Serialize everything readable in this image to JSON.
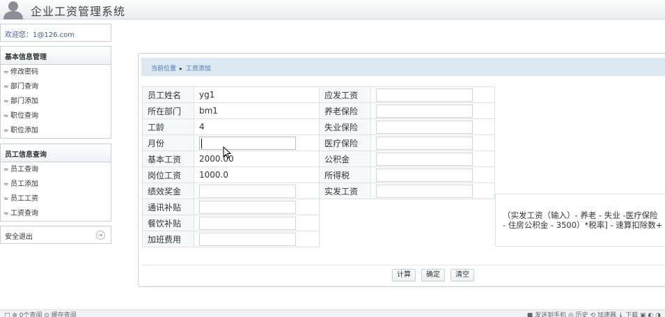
{
  "header": {
    "title": "企业工资管理系统"
  },
  "welcome": "欢迎您：1@126.com",
  "sidebar": {
    "groups": [
      {
        "title": "基本信息管理",
        "items": [
          "修改密码",
          "部门查询",
          "部门添加",
          "职位查询",
          "职位添加"
        ]
      },
      {
        "title": "员工信息查询",
        "items": [
          "员工查询",
          "员工添加",
          "员工工资",
          "工资查询"
        ]
      }
    ],
    "logout": "安全退出",
    "item_marker": "≈"
  },
  "breadcrumb": {
    "prefix": "当前位置",
    "separator": "▸",
    "current": "工资添加"
  },
  "form": {
    "left": [
      {
        "label": "员工姓名",
        "value": "yg1"
      },
      {
        "label": "所在部门",
        "value": "bm1"
      },
      {
        "label": "工龄",
        "value": "4"
      },
      {
        "label": "月份",
        "value": ""
      },
      {
        "label": "基本工资",
        "value": "2000.00"
      },
      {
        "label": "岗位工资",
        "value": "1000.0"
      },
      {
        "label": "绩效奖金",
        "value": ""
      },
      {
        "label": "通讯补贴",
        "value": ""
      },
      {
        "label": "餐饮补贴",
        "value": ""
      },
      {
        "label": "加班费用",
        "value": ""
      }
    ],
    "right": [
      {
        "label": "应发工资",
        "value": ""
      },
      {
        "label": "养老保险",
        "value": ""
      },
      {
        "label": "失业保险",
        "value": ""
      },
      {
        "label": "医疗保险",
        "value": ""
      },
      {
        "label": "公积金",
        "value": ""
      },
      {
        "label": "所得税",
        "value": ""
      },
      {
        "label": "实发工资",
        "value": ""
      }
    ],
    "formula_line1": "（实发工资（输入）- 养老 - 失业 -医疗保险",
    "formula_line2": "- 住房公积金 - 3500）*税率] - 速算扣除数+"
  },
  "buttons": {
    "calc": "计算",
    "confirm": "确定",
    "clear": "清空"
  },
  "taskbar": {
    "left": "□  ⊕ 0个查阅   ⊙ 缓存查阅",
    "right": "■ 发送到手机  ◎ 历史  ⟲ 加速器  ↓ 下载  ▣  ◐  ◑"
  }
}
